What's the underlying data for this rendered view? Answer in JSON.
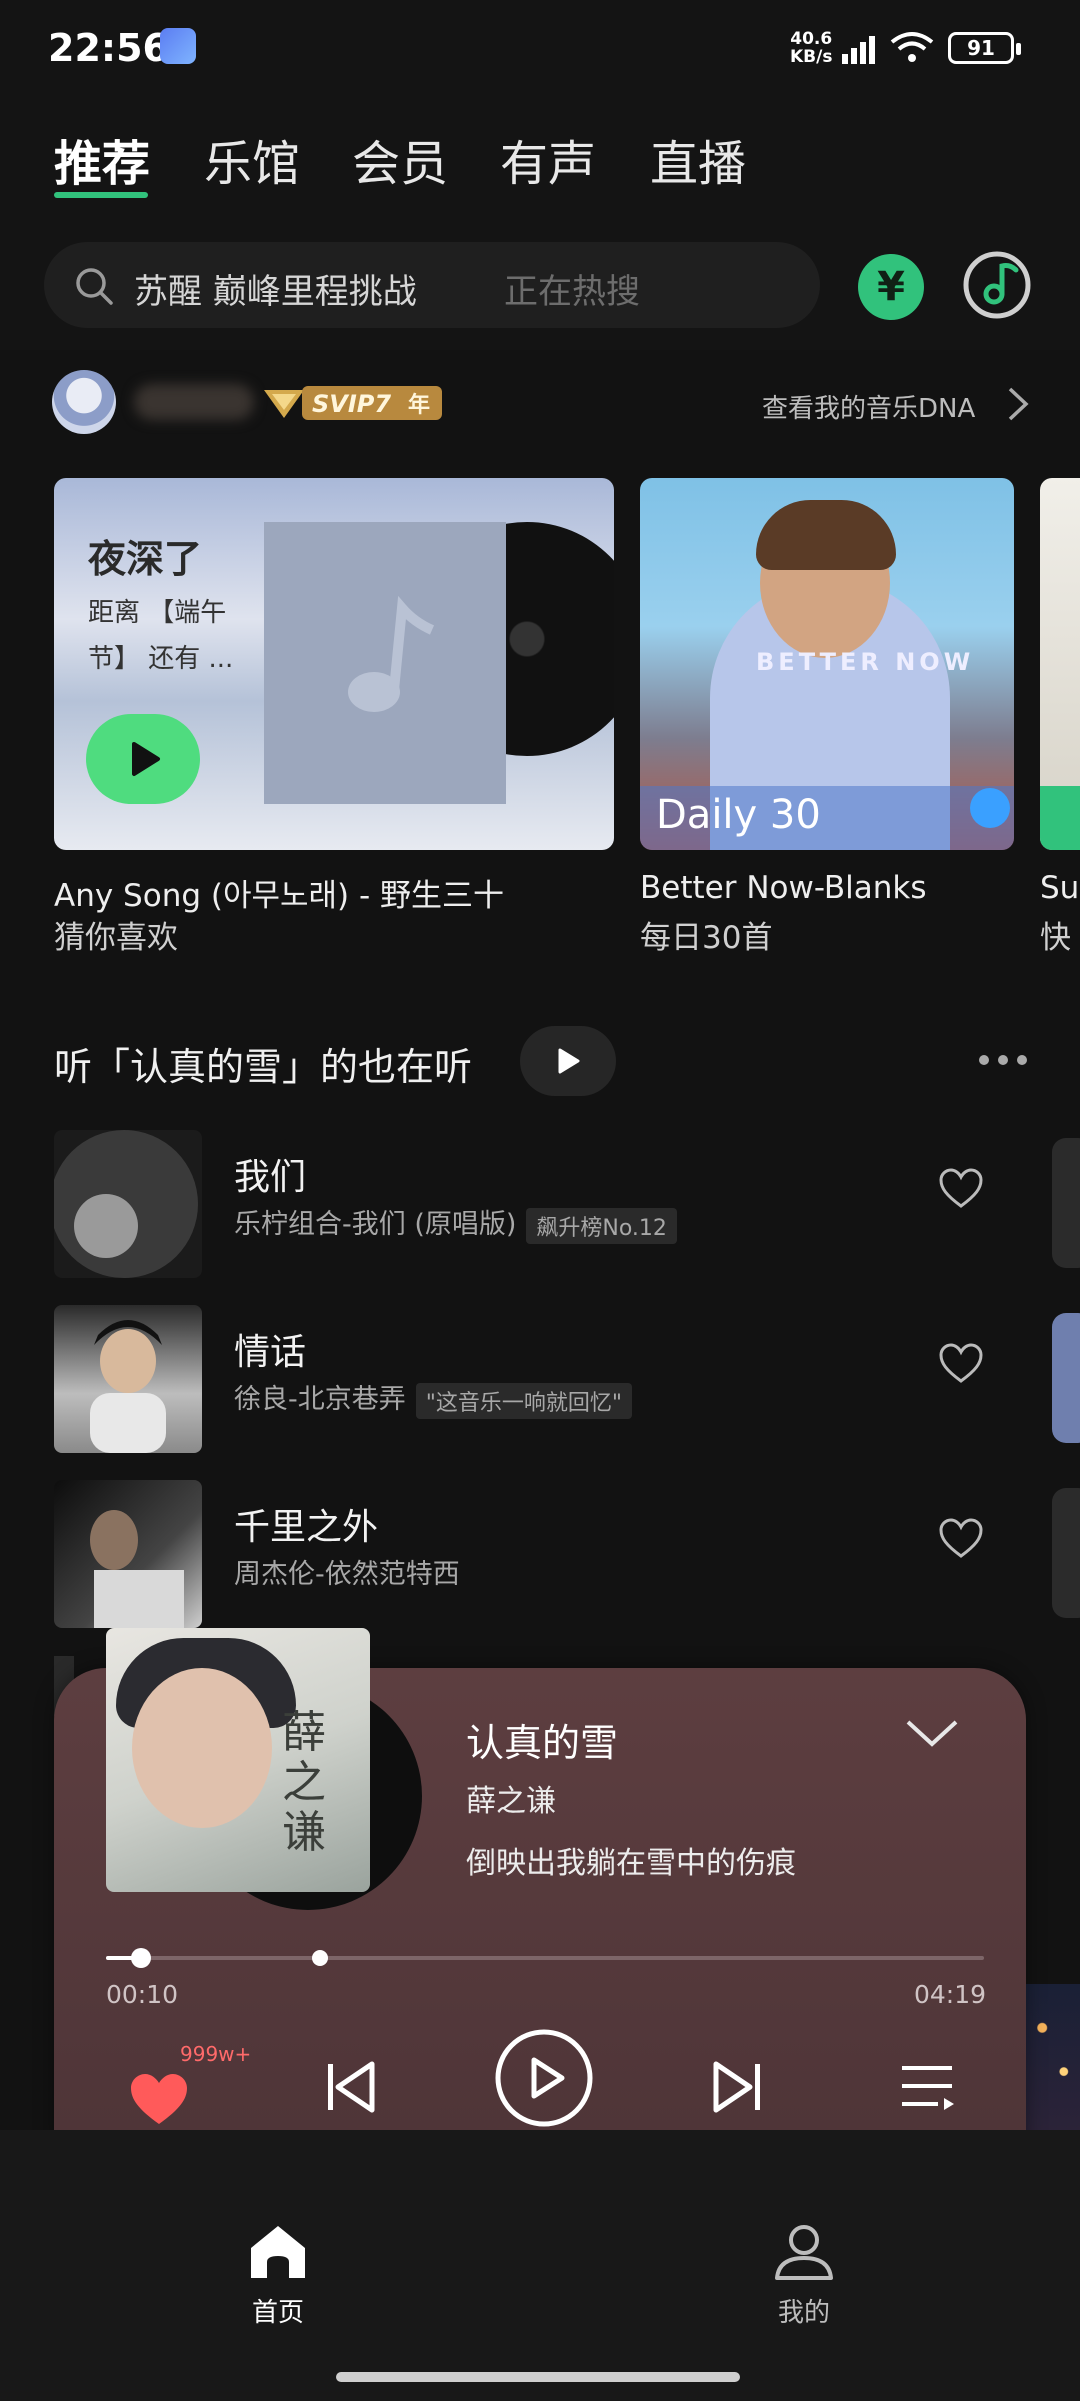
{
  "status_bar": {
    "time": "22:56",
    "speed_value": "40.6",
    "speed_unit": "KB/s",
    "battery": "91"
  },
  "tabs": [
    {
      "label": "推荐",
      "active": true
    },
    {
      "label": "乐馆"
    },
    {
      "label": "会员"
    },
    {
      "label": "有声"
    },
    {
      "label": "直播"
    }
  ],
  "search": {
    "query": "苏醒 巅峰里程挑战",
    "hint": "正在热搜"
  },
  "header_buttons": {
    "vip_symbol": "¥"
  },
  "profile": {
    "badge": "SVIP7",
    "badge_suffix": "年",
    "dna_link": "查看我的音乐DNA"
  },
  "cards": [
    {
      "title": "夜深了",
      "desc": "距离 【端午节】 还有 ...",
      "caption": "Any Song (아무노래) - 野生三十",
      "sub": "猜你喜欢"
    },
    {
      "overlay": "BETTER NOW",
      "badge": "Daily 30",
      "caption": "Better Now-Blanks",
      "sub": "每日30首"
    },
    {
      "caption": "Su",
      "sub": "快"
    }
  ],
  "section": {
    "title": "听「认真的雪」的也在听"
  },
  "songs": [
    {
      "name": "我们",
      "meta": "乐柠组合-我们 (原唱版)",
      "tag": "飙升榜No.12"
    },
    {
      "name": "情话",
      "meta": "徐良-北京巷弄",
      "tag": "\"这音乐一响就回忆\""
    },
    {
      "name": "千里之外",
      "meta": "周杰伦-依然范特西",
      "tag": ""
    }
  ],
  "player": {
    "song": "认真的雪",
    "artist": "薛之谦",
    "lyric": "倒映出我躺在雪中的伤痕",
    "cover_text": "薛之谦",
    "current": "00:10",
    "total": "04:19",
    "likes": "999w+",
    "progress": 0.04
  },
  "bottom_nav": [
    {
      "label": "首页",
      "active": true
    },
    {
      "label": "我的"
    }
  ],
  "colors": {
    "accent": "#31c27c",
    "player_bg": "#5d3e40",
    "like": "#ff5a5a"
  }
}
